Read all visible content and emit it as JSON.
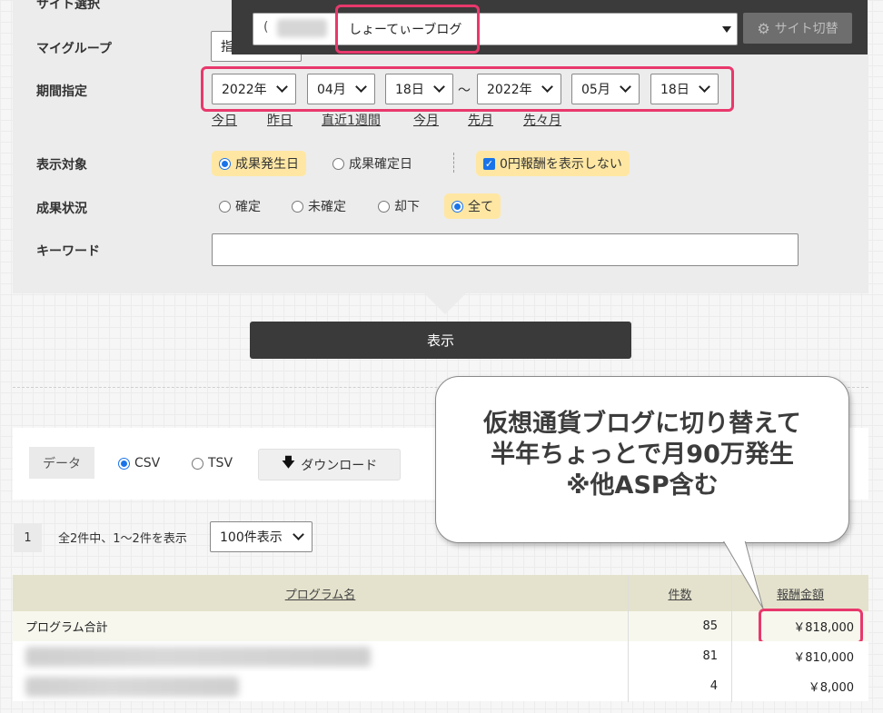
{
  "form": {
    "site_select_label": "サイト選択",
    "my_group_label": "マイグループ",
    "my_group_value": "指",
    "period_label": "期間指定",
    "period": {
      "from_year": "2022年",
      "from_month": "04月",
      "from_day": "18日",
      "tilde": "〜",
      "to_year": "2022年",
      "to_month": "05月",
      "to_day": "18日"
    },
    "quick_links": [
      "今日",
      "昨日",
      "直近1週間",
      "今月",
      "先月",
      "先々月"
    ],
    "display_target_label": "表示対象",
    "display_target": {
      "occurred": "成果発生日",
      "confirmed": "成果確定日",
      "hide_zero": "0円報酬を表示しない"
    },
    "status_label": "成果状況",
    "status": [
      "確定",
      "未確定",
      "却下",
      "全て"
    ],
    "keyword_label": "キーワード",
    "keyword_value": ""
  },
  "site_switch": {
    "prefix": "(",
    "site_name": "しょーてぃーブログ",
    "button_label": "サイト切替"
  },
  "submit_label": "表示",
  "download": {
    "data_label": "データ",
    "csv": "CSV",
    "tsv": "TSV",
    "button_label": "ダウンロード"
  },
  "pagination": {
    "page": "1",
    "summary": "全2件中、1〜2件を表示",
    "per_page": "100件表示"
  },
  "table": {
    "headers": [
      "プログラム名",
      "件数",
      "報酬金額"
    ],
    "rows": [
      {
        "name": "プログラム合計",
        "count": "85",
        "amount": "￥818,000"
      },
      {
        "name": "",
        "count": "81",
        "amount": "￥810,000"
      },
      {
        "name": "",
        "count": "4",
        "amount": "￥8,000"
      }
    ]
  },
  "annotation": {
    "lines": [
      "仮想通貨ブログに切り替えて",
      "半年ちょっとで月90万発生",
      "※他ASP含む"
    ]
  },
  "colors": {
    "highlight_border": "#e8386c",
    "option_highlight": "#ffe7a3",
    "table_header": "#e4e2cc",
    "dark_button": "#3a3a3a"
  }
}
